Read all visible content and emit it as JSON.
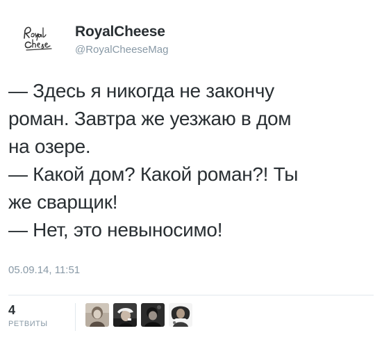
{
  "profile": {
    "display_name": "RoyalCheese",
    "handle": "@RoyalCheeseMag",
    "avatar_icon": "royal-cheese-logo-icon"
  },
  "tweet": {
    "lines": [
      "— Здесь я никогда не закончу",
      "роман. Завтра же уезжаю в дом",
      "на озере.",
      "— Какой дом? Какой роман?! Ты",
      "же сварщик!",
      "— Нет, это невыносимо!"
    ],
    "timestamp": "05.09.14, 11:51"
  },
  "stats": {
    "retweets_count": "4",
    "retweets_label": "РЕТВИТЫ"
  },
  "retweeters": [
    {
      "icon": "retweeter-avatar-1-icon"
    },
    {
      "icon": "retweeter-avatar-2-icon"
    },
    {
      "icon": "retweeter-avatar-3-icon"
    },
    {
      "icon": "retweeter-avatar-4-icon"
    }
  ],
  "colors": {
    "text": "#292f33",
    "secondary": "#8899a6",
    "divider": "#e1e8ed"
  }
}
